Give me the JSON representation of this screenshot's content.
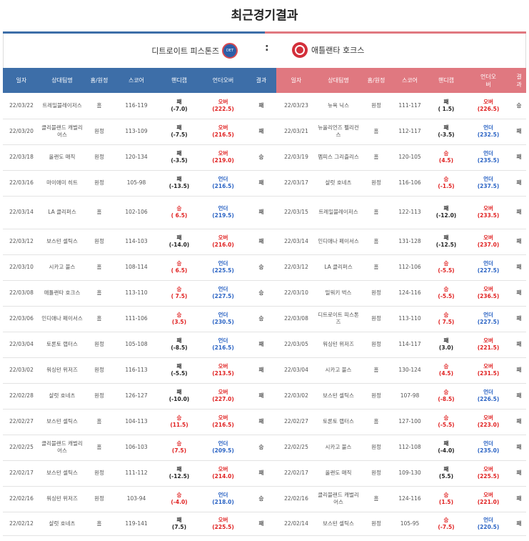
{
  "title": "최근경기결과",
  "teams": {
    "left": "디트로이트 피스톤즈",
    "vs": ":",
    "right": "애틀랜타 호크스"
  },
  "headers": {
    "left": [
      "일자",
      "상대팀명",
      "홈/원정",
      "스코어",
      "핸디캡",
      "언더오버",
      "결과"
    ],
    "right": [
      "일자",
      "상대팀명",
      "홈/원정",
      "스코어",
      "핸디캡",
      "언더오\n버",
      "결\n과"
    ]
  },
  "left_rows": [
    {
      "date": "22/03/22",
      "opp": "트레일블레이저스",
      "ha": "홈",
      "score": "116-119",
      "hc_r": "패",
      "hc_v": "(-7.0)",
      "ou_r": "오버",
      "ou_v": "(222.5)",
      "res": "패"
    },
    {
      "date": "22/03/20",
      "opp": "클리블랜드 캐벌리어스",
      "ha": "원정",
      "score": "113-109",
      "hc_r": "패",
      "hc_v": "(-7.5)",
      "ou_r": "오버",
      "ou_v": "(216.5)",
      "res": "패"
    },
    {
      "date": "22/03/18",
      "opp": "올랜도 매직",
      "ha": "원정",
      "score": "120-134",
      "hc_r": "패",
      "hc_v": "(-3.5)",
      "ou_r": "오버",
      "ou_v": "(219.0)",
      "res": "승"
    },
    {
      "date": "22/03/16",
      "opp": "마이애미 히트",
      "ha": "원정",
      "score": "105-98",
      "hc_r": "패",
      "hc_v": "(-13.5)",
      "ou_r": "언더",
      "ou_v": "(216.5)",
      "res": "패"
    },
    {
      "date": "22/03/14",
      "opp": "LA 클리퍼스",
      "ha": "홈",
      "score": "102-106",
      "hc_r": "승",
      "hc_v": "( 6.5)",
      "ou_r": "언더",
      "ou_v": "(219.5)",
      "res": "패"
    },
    {
      "date": "22/03/12",
      "opp": "보스턴 셀틱스",
      "ha": "원정",
      "score": "114-103",
      "hc_r": "패",
      "hc_v": "(-14.0)",
      "ou_r": "오버",
      "ou_v": "(216.0)",
      "res": "패"
    },
    {
      "date": "22/03/10",
      "opp": "시카고 불스",
      "ha": "홈",
      "score": "108-114",
      "hc_r": "승",
      "hc_v": "( 6.5)",
      "ou_r": "언더",
      "ou_v": "(225.5)",
      "res": "승"
    },
    {
      "date": "22/03/08",
      "opp": "애틀랜타 호크스",
      "ha": "홈",
      "score": "113-110",
      "hc_r": "승",
      "hc_v": "( 7.5)",
      "ou_r": "언더",
      "ou_v": "(227.5)",
      "res": "승"
    },
    {
      "date": "22/03/06",
      "opp": "인디애나 페이서스",
      "ha": "홈",
      "score": "111-106",
      "hc_r": "승",
      "hc_v": "(3.5)",
      "ou_r": "언더",
      "ou_v": "(230.5)",
      "res": "승"
    },
    {
      "date": "22/03/04",
      "opp": "토론토 랩터스",
      "ha": "원정",
      "score": "105-108",
      "hc_r": "패",
      "hc_v": "(-8.5)",
      "ou_r": "언더",
      "ou_v": "(216.5)",
      "res": "패"
    },
    {
      "date": "22/03/02",
      "opp": "워싱턴 위저즈",
      "ha": "원정",
      "score": "116-113",
      "hc_r": "패",
      "hc_v": "(-5.5)",
      "ou_r": "오버",
      "ou_v": "(213.5)",
      "res": "패"
    },
    {
      "date": "22/02/28",
      "opp": "샬럿 호네츠",
      "ha": "원정",
      "score": "126-127",
      "hc_r": "패",
      "hc_v": "(-10.0)",
      "ou_r": "오버",
      "ou_v": "(227.0)",
      "res": "패"
    },
    {
      "date": "22/02/27",
      "opp": "보스턴 셀틱스",
      "ha": "홈",
      "score": "104-113",
      "hc_r": "승",
      "hc_v": "(11.5)",
      "ou_r": "오버",
      "ou_v": "(216.5)",
      "res": "패"
    },
    {
      "date": "22/02/25",
      "opp": "클리블랜드 캐벌리어스",
      "ha": "홈",
      "score": "106-103",
      "hc_r": "승",
      "hc_v": "(7.5)",
      "ou_r": "언더",
      "ou_v": "(209.5)",
      "res": "승"
    },
    {
      "date": "22/02/17",
      "opp": "보스턴 셀틱스",
      "ha": "원정",
      "score": "111-112",
      "hc_r": "패",
      "hc_v": "(-12.5)",
      "ou_r": "오버",
      "ou_v": "(214.0)",
      "res": "패"
    },
    {
      "date": "22/02/16",
      "opp": "워싱턴 위저즈",
      "ha": "원정",
      "score": "103-94",
      "hc_r": "승",
      "hc_v": "(-4.0)",
      "ou_r": "언더",
      "ou_v": "(218.0)",
      "res": "승"
    },
    {
      "date": "22/02/12",
      "opp": "샬럿 호네츠",
      "ha": "홈",
      "score": "119-141",
      "hc_r": "패",
      "hc_v": "(7.5)",
      "ou_r": "오버",
      "ou_v": "(225.5)",
      "res": "패"
    }
  ],
  "right_rows": [
    {
      "date": "22/03/23",
      "opp": "뉴욕 닉스",
      "ha": "원정",
      "score": "111-117",
      "hc_r": "패",
      "hc_v": "( 1.5)",
      "ou_r": "오버",
      "ou_v": "(226.5)",
      "res": "승"
    },
    {
      "date": "22/03/21",
      "opp": "뉴올리언즈 펠리컨스",
      "ha": "홈",
      "score": "112-117",
      "hc_r": "패",
      "hc_v": "(-3.5)",
      "ou_r": "언더",
      "ou_v": "(232.5)",
      "res": "패"
    },
    {
      "date": "22/03/19",
      "opp": "멤피스 그리즐리스",
      "ha": "홈",
      "score": "120-105",
      "hc_r": "승",
      "hc_v": "(4.5)",
      "ou_r": "언더",
      "ou_v": "(235.5)",
      "res": "패"
    },
    {
      "date": "22/03/17",
      "opp": "샬럿 호네츠",
      "ha": "원정",
      "score": "116-106",
      "hc_r": "승",
      "hc_v": "(-1.5)",
      "ou_r": "언더",
      "ou_v": "(237.5)",
      "res": "패"
    },
    {
      "date": "22/03/15",
      "opp": "트레일블레이저스",
      "ha": "홈",
      "score": "122-113",
      "hc_r": "패",
      "hc_v": "(-12.0)",
      "ou_r": "오버",
      "ou_v": "(233.5)",
      "res": "패"
    },
    {
      "date": "22/03/14",
      "opp": "인디애나 페이서스",
      "ha": "홈",
      "score": "131-128",
      "hc_r": "패",
      "hc_v": "(-12.5)",
      "ou_r": "오버",
      "ou_v": "(237.0)",
      "res": "패"
    },
    {
      "date": "22/03/12",
      "opp": "LA 클리퍼스",
      "ha": "홈",
      "score": "112-106",
      "hc_r": "승",
      "hc_v": "(-5.5)",
      "ou_r": "언더",
      "ou_v": "(227.5)",
      "res": "패"
    },
    {
      "date": "22/03/10",
      "opp": "밀워키 벅스",
      "ha": "원정",
      "score": "124-116",
      "hc_r": "승",
      "hc_v": "(-5.5)",
      "ou_r": "오버",
      "ou_v": "(236.5)",
      "res": "패"
    },
    {
      "date": "22/03/08",
      "opp": "디트로이트 피스톤즈",
      "ha": "원정",
      "score": "113-110",
      "hc_r": "승",
      "hc_v": "( 7.5)",
      "ou_r": "언더",
      "ou_v": "(227.5)",
      "res": "패"
    },
    {
      "date": "22/03/05",
      "opp": "워싱턴 위저즈",
      "ha": "원정",
      "score": "114-117",
      "hc_r": "패",
      "hc_v": "(3.0)",
      "ou_r": "오버",
      "ou_v": "(221.5)",
      "res": "패"
    },
    {
      "date": "22/03/04",
      "opp": "시카고 불스",
      "ha": "홈",
      "score": "130-124",
      "hc_r": "승",
      "hc_v": "(4.5)",
      "ou_r": "오버",
      "ou_v": "(231.5)",
      "res": "패"
    },
    {
      "date": "22/03/02",
      "opp": "보스턴 셀틱스",
      "ha": "원정",
      "score": "107-98",
      "hc_r": "승",
      "hc_v": "(-8.5)",
      "ou_r": "언더",
      "ou_v": "(226.5)",
      "res": "패"
    },
    {
      "date": "22/02/27",
      "opp": "토론토 랩터스",
      "ha": "홈",
      "score": "127-100",
      "hc_r": "승",
      "hc_v": "(-5.5)",
      "ou_r": "오버",
      "ou_v": "(223.0)",
      "res": "패"
    },
    {
      "date": "22/02/25",
      "opp": "시카고 불스",
      "ha": "원정",
      "score": "112-108",
      "hc_r": "패",
      "hc_v": "(-4.0)",
      "ou_r": "언더",
      "ou_v": "(235.0)",
      "res": "패"
    },
    {
      "date": "22/02/17",
      "opp": "올랜도 매직",
      "ha": "원정",
      "score": "109-130",
      "hc_r": "패",
      "hc_v": "(5.5)",
      "ou_r": "오버",
      "ou_v": "(225.5)",
      "res": "패"
    },
    {
      "date": "22/02/16",
      "opp": "클리블랜드 캐벌리어스",
      "ha": "홈",
      "score": "124-116",
      "hc_r": "승",
      "hc_v": "(1.5)",
      "ou_r": "오버",
      "ou_v": "(221.0)",
      "res": "패"
    },
    {
      "date": "22/02/14",
      "opp": "보스턴 셀틱스",
      "ha": "원정",
      "score": "105-95",
      "hc_r": "승",
      "hc_v": "(-7.5)",
      "ou_r": "언더",
      "ou_v": "(220.5)",
      "res": "패"
    }
  ],
  "colors": {
    "left_accent": "#3d6ea8",
    "right_accent": "#e07880",
    "win": "#e02020",
    "under": "#2a63c4"
  }
}
